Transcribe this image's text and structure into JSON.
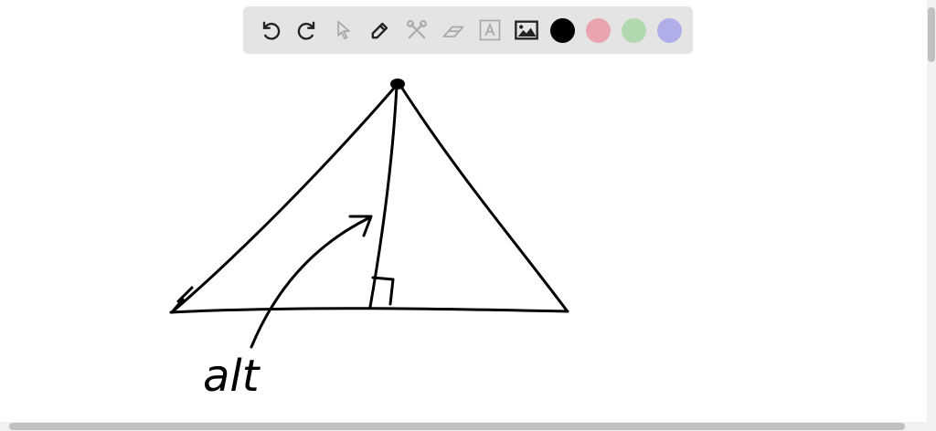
{
  "toolbar": {
    "tools": [
      {
        "name": "undo",
        "icon": "undo-icon",
        "enabled": true
      },
      {
        "name": "redo",
        "icon": "redo-icon",
        "enabled": true
      },
      {
        "name": "select",
        "icon": "cursor-icon",
        "enabled": false
      },
      {
        "name": "pen",
        "icon": "pencil-icon",
        "enabled": true
      },
      {
        "name": "tools",
        "icon": "tools-icon",
        "enabled": false
      },
      {
        "name": "eraser",
        "icon": "eraser-icon",
        "enabled": false
      },
      {
        "name": "text",
        "icon": "text-icon",
        "enabled": false
      },
      {
        "name": "image",
        "icon": "image-icon",
        "enabled": true
      }
    ],
    "colors": [
      "#000000",
      "#e8a5ae",
      "#b2d8b0",
      "#b0aee8"
    ],
    "selected_color": "#000000"
  },
  "drawing": {
    "annotation": "alt"
  }
}
